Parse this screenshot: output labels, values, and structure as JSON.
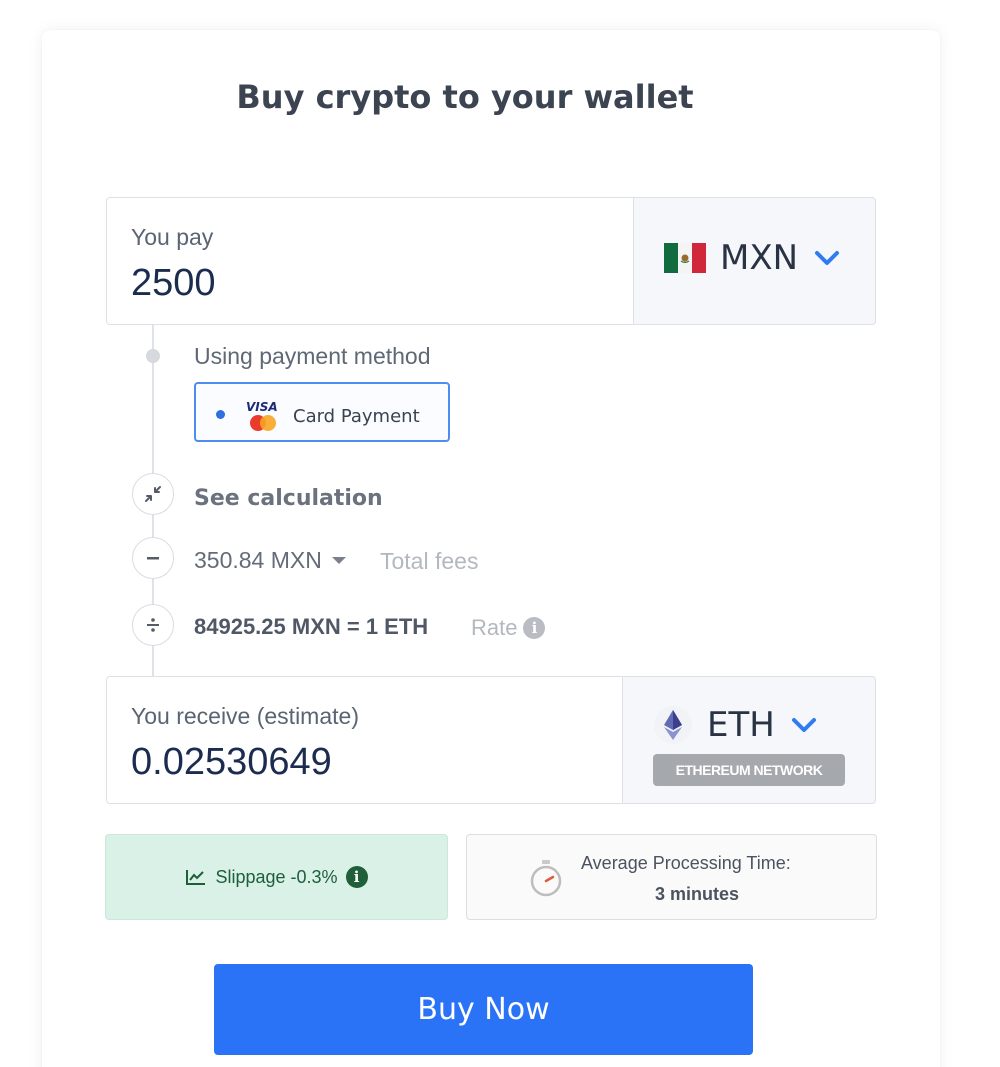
{
  "header": {
    "title": "Buy crypto to your wallet"
  },
  "pay": {
    "label": "You pay",
    "amount": "2500",
    "currency": {
      "code": "MXN",
      "icon": "mexico-flag-icon"
    }
  },
  "payment_method": {
    "label": "Using payment method",
    "option": "Card Payment",
    "card_logo_text": "VISA"
  },
  "calculation": {
    "see_label": "See calculation",
    "fees_amount": "350.84 MXN",
    "fees_label": "Total fees",
    "rate_value": "84925.25 MXN = 1 ETH",
    "rate_label": "Rate"
  },
  "receive": {
    "label": "You receive (estimate)",
    "amount": "0.02530649",
    "currency": {
      "code": "ETH",
      "icon": "ethereum-icon",
      "network": "ETHEREUM NETWORK"
    }
  },
  "slippage": {
    "text": "Slippage -0.3%"
  },
  "processing": {
    "title": "Average Processing Time:",
    "value": "3 minutes"
  },
  "actions": {
    "buy_label": "Buy Now"
  },
  "colors": {
    "accent": "#2b73f6",
    "slippage_bg": "#d9f1e6",
    "slippage_text": "#1d5f3b",
    "chevron": "#2f7bf0"
  }
}
